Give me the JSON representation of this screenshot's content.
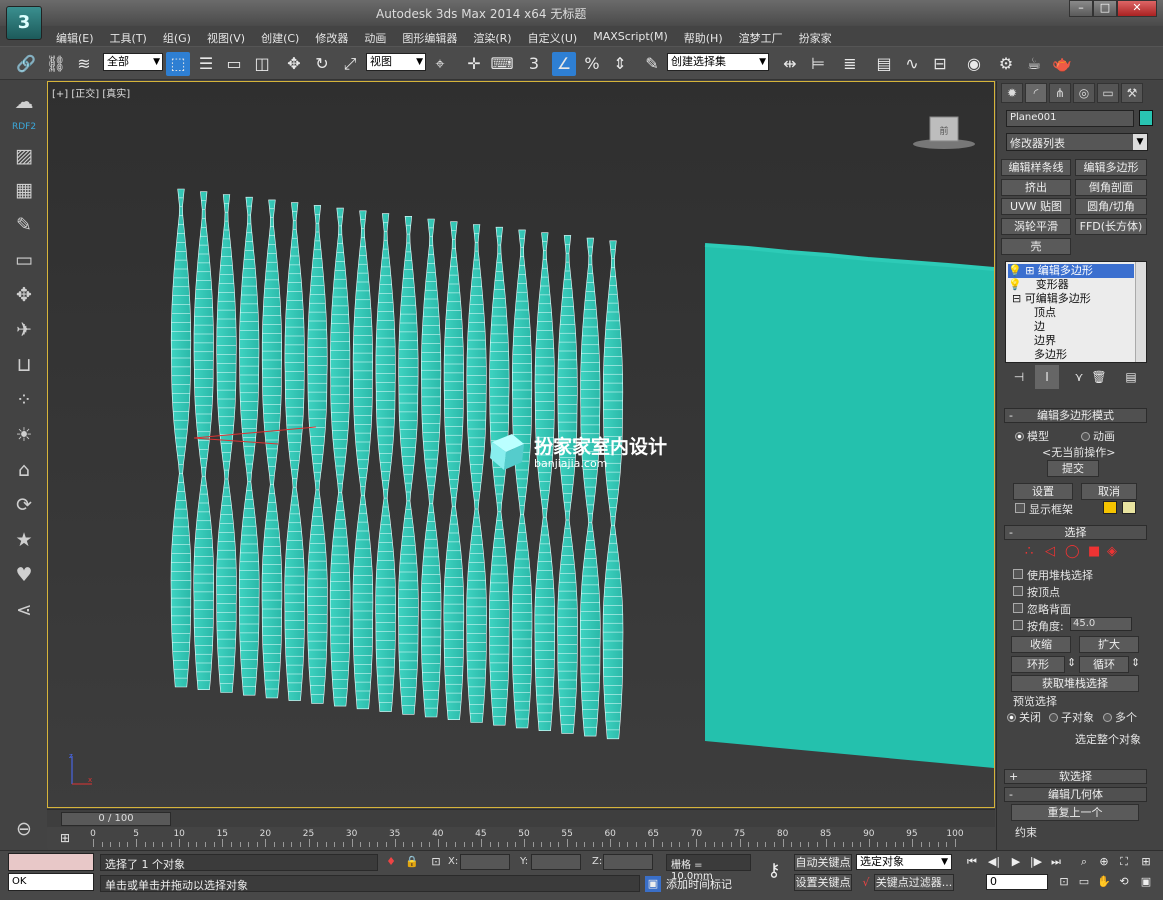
{
  "window": {
    "title": "Autodesk 3ds Max  2014 x64      无标题",
    "logo": "3"
  },
  "menu": [
    "编辑(E)",
    "工具(T)",
    "组(G)",
    "视图(V)",
    "创建(C)",
    "修改器",
    "动画",
    "图形编辑器",
    "渲染(R)",
    "自定义(U)",
    "MAXScript(M)",
    "帮助(H)",
    "渲梦工厂",
    "扮家家"
  ],
  "toolbar": {
    "filter_value": "全部",
    "refcoord_value": "视图",
    "named_selection_value": "创建选择集",
    "snap_label": "3"
  },
  "sidebar": {
    "brand": "RDF2"
  },
  "viewport": {
    "label": "[+] [正交] [真实]",
    "watermark_title": "扮家家室内设计",
    "watermark_url": "banjiajia.com"
  },
  "command_panel": {
    "object_name": "Plane001",
    "object_color": "#29c4b2",
    "modifier_list": "修改器列表",
    "modifier_buttons": [
      "编辑样条线",
      "编辑多边形",
      "挤出",
      "倒角剖面",
      "UVW 贴图",
      "圆角/切角",
      "涡轮平滑",
      "FFD(长方体)",
      "壳"
    ],
    "stack": [
      "编辑多边形",
      "变形器",
      "可编辑多边形",
      "顶点",
      "边",
      "边界",
      "多边形"
    ],
    "edit_poly_mode": {
      "title": "编辑多边形模式",
      "model": "模型",
      "animate": "动画",
      "no_op": "<无当前操作>",
      "commit": "提交",
      "settings": "设置",
      "cancel": "取消",
      "show_cage": "显示框架"
    },
    "selection": {
      "title": "选择",
      "use_stack": "使用堆栈选择",
      "by_vertex": "按顶点",
      "ignore_back": "忽略背面",
      "by_angle": "按角度:",
      "angle_value": "45.0",
      "shrink": "收缩",
      "grow": "扩大",
      "ring": "环形",
      "loop": "循环",
      "get_stack": "获取堆栈选择",
      "preview": "预览选择",
      "off": "关闭",
      "subobj": "子对象",
      "multi": "多个",
      "select_whole": "选定整个对象"
    },
    "soft_sel": "软选择",
    "edit_geom": "编辑几何体",
    "repeat_last": "重复上一个",
    "constraints": "约束"
  },
  "timeline": {
    "frame": "0 / 100",
    "ticks": [
      0,
      5,
      10,
      15,
      20,
      25,
      30,
      35,
      40,
      45,
      50,
      55,
      60,
      65,
      70,
      75,
      80,
      85,
      90,
      95,
      100
    ]
  },
  "status": {
    "maxscript_out": "OK",
    "selected_msg": "选择了 1 个对象",
    "prompt": "单击或单击并拖动以选择对象",
    "x_label": "X:",
    "y_label": "Y:",
    "z_label": "Z:",
    "grid": "栅格 = 10.0mm",
    "add_time_tag": "添加时间标记",
    "auto_key": "自动关键点",
    "set_key": "设置关键点",
    "key_mode_value": "选定对象",
    "key_filters": "关键点过滤器...",
    "current_frame": "0"
  }
}
